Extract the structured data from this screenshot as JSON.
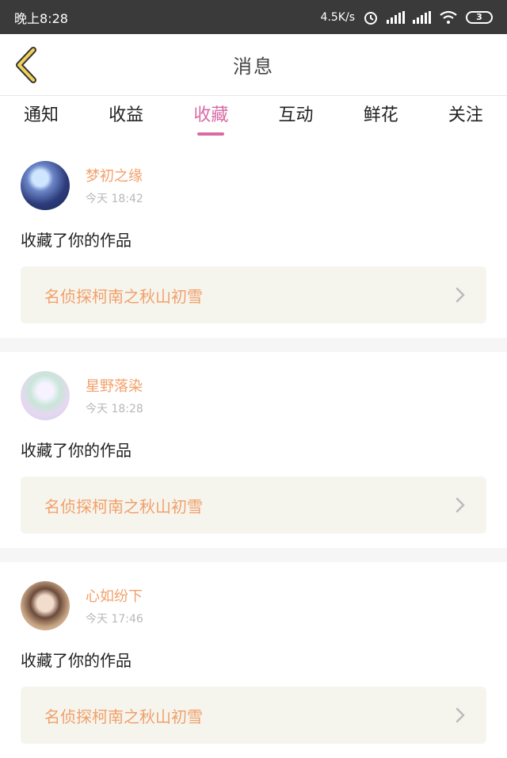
{
  "status_bar": {
    "time": "晚上8:28",
    "speed": "4.5K/s",
    "battery": "3"
  },
  "header": {
    "title": "消息"
  },
  "tabs": [
    {
      "label": "通知",
      "active": false
    },
    {
      "label": "收益",
      "active": false
    },
    {
      "label": "收藏",
      "active": true
    },
    {
      "label": "互动",
      "active": false
    },
    {
      "label": "鲜花",
      "active": false
    },
    {
      "label": "关注",
      "active": false
    }
  ],
  "cards": [
    {
      "name": "梦初之缘",
      "time": "今天 18:42",
      "action": "收藏了你的作品",
      "work": "名侦探柯南之秋山初雪"
    },
    {
      "name": "星野落染",
      "time": "今天 18:28",
      "action": "收藏了你的作品",
      "work": "名侦探柯南之秋山初雪"
    },
    {
      "name": "心如纷下",
      "time": "今天 17:46",
      "action": "收藏了你的作品",
      "work": "名侦探柯南之秋山初雪"
    }
  ],
  "colors": {
    "accent": "#d86ba5",
    "name": "#f2a06a",
    "back_arrow": "#f0d25a"
  }
}
